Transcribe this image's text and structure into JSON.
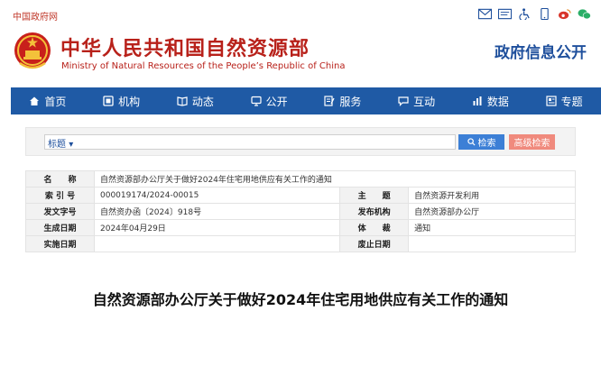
{
  "topbar": {
    "gov_link": "中国政府网",
    "icons": [
      "mail-icon",
      "mail-alt-icon",
      "accessibility-icon",
      "mobile-app-icon",
      "weibo-icon",
      "wechat-icon"
    ]
  },
  "header": {
    "title": "中华人民共和国自然资源部",
    "subtitle": "Ministry of Natural Resources of the People’s Republic of China",
    "section": "政府信息公开"
  },
  "nav": {
    "items": [
      {
        "label": "首页",
        "icon": "home-icon"
      },
      {
        "label": "机构",
        "icon": "organization-icon"
      },
      {
        "label": "动态",
        "icon": "news-icon"
      },
      {
        "label": "公开",
        "icon": "monitor-icon"
      },
      {
        "label": "服务",
        "icon": "edit-icon"
      },
      {
        "label": "互动",
        "icon": "chat-icon"
      },
      {
        "label": "数据",
        "icon": "bar-chart-icon"
      },
      {
        "label": "专题",
        "icon": "topic-icon"
      }
    ]
  },
  "search": {
    "select_label": "标题",
    "placeholder": "",
    "search_button": "检索",
    "advanced_button": "高级检索"
  },
  "meta": {
    "name_label": "名　　称",
    "name_value": "自然资源部办公厅关于做好2024年住宅用地供应有关工作的通知",
    "index_label": "索 引 号",
    "index_value": "000019174/2024-00015",
    "topic_label": "主　　题",
    "topic_value": "自然资源开发利用",
    "docno_label": "发文字号",
    "docno_value": "自然资办函〔2024〕918号",
    "issuer_label": "发布机构",
    "issuer_value": "自然资源部办公厅",
    "date_label": "生成日期",
    "date_value": "2024年04月29日",
    "genre_label": "体　　裁",
    "genre_value": "通知",
    "effective_label": "实施日期",
    "effective_value": "",
    "expire_label": "废止日期",
    "expire_value": ""
  },
  "document": {
    "title": "自然资源部办公厅关于做好2024年住宅用地供应有关工作的通知"
  },
  "colors": {
    "brand_red": "#b8211a",
    "nav_blue": "#1f5aa5",
    "search_blue": "#3c7fd6",
    "advanced_salmon": "#f08a7d"
  }
}
